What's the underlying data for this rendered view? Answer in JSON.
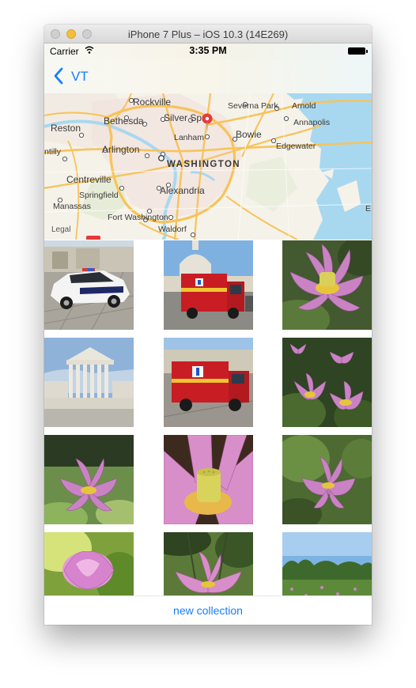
{
  "window": {
    "title": "iPhone 7 Plus – iOS 10.3 (14E269)"
  },
  "status_bar": {
    "carrier": "Carrier",
    "time": "3:35 PM"
  },
  "nav_bar": {
    "back_label": "VT"
  },
  "map": {
    "labels": {
      "rockville": "Rockville",
      "severna_park": "Severna Park",
      "arnold": "Arnold",
      "bethesda": "Bethesda",
      "silver_spring": "Silver Spri",
      "annapolis": "Annapolis",
      "reston": "Reston",
      "lanham": "Lanham",
      "bowie": "Bowie",
      "chantilly": "ntilly",
      "arlington": "Arlington",
      "edgewater": "Edgewater",
      "washington": "WASHINGTON",
      "centreville": "Centreville",
      "springfield": "Springfield",
      "alexandria": "Alexandria",
      "manassas": "Manassas",
      "fort_washington": "Fort Washington",
      "waldorf": "Waldorf",
      "legal": "Legal",
      "edge_e": "E"
    },
    "colors": {
      "water": "#a8d8f0",
      "land": "#f5f2e9",
      "highway": "#f7c35a",
      "pin": "#e8393a"
    }
  },
  "photos": [
    {
      "subject": "police-car"
    },
    {
      "subject": "ambulance-capitol"
    },
    {
      "subject": "lotus-flower"
    },
    {
      "subject": "supreme-court"
    },
    {
      "subject": "ambulance"
    },
    {
      "subject": "lotus-flowers"
    },
    {
      "subject": "lotus-flower"
    },
    {
      "subject": "lotus-closeup"
    },
    {
      "subject": "lotus-flower"
    },
    {
      "subject": "lotus-bud"
    },
    {
      "subject": "lotus-flower"
    },
    {
      "subject": "lotus-field"
    }
  ],
  "footer": {
    "new_collection_label": "new collection"
  },
  "colors": {
    "tint": "#147efb"
  }
}
